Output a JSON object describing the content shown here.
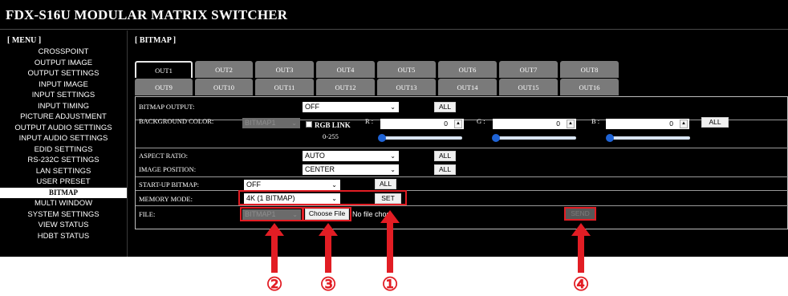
{
  "app": {
    "title": "FDX-S16U MODULAR MATRIX SWITCHER"
  },
  "menu": {
    "header": "[ MENU ]",
    "items": [
      {
        "label": "CROSSPOINT"
      },
      {
        "label": "OUTPUT IMAGE"
      },
      {
        "label": "OUTPUT SETTINGS"
      },
      {
        "label": "INPUT IMAGE"
      },
      {
        "label": "INPUT SETTINGS"
      },
      {
        "label": "INPUT TIMING"
      },
      {
        "label": "PICTURE ADJUSTMENT"
      },
      {
        "label": "OUTPUT AUDIO SETTINGS"
      },
      {
        "label": "INPUT AUDIO SETTINGS"
      },
      {
        "label": "EDID SETTINGS"
      },
      {
        "label": "RS-232C SETTINGS"
      },
      {
        "label": "LAN SETTINGS"
      },
      {
        "label": "USER PRESET"
      },
      {
        "label": "BITMAP",
        "active": true
      },
      {
        "label": "MULTI WINDOW"
      },
      {
        "label": "SYSTEM SETTINGS"
      },
      {
        "label": "VIEW STATUS"
      },
      {
        "label": "HDBT STATUS"
      }
    ]
  },
  "section": {
    "title": "[ BITMAP ]"
  },
  "tabs": {
    "active": "OUT1",
    "row1": [
      "OUT1",
      "OUT2",
      "OUT3",
      "OUT4",
      "OUT5",
      "OUT6",
      "OUT7",
      "OUT8"
    ],
    "row2": [
      "OUT9",
      "OUT10",
      "OUT11",
      "OUT12",
      "OUT13",
      "OUT14",
      "OUT15",
      "OUT16"
    ]
  },
  "bitmap_output": {
    "label": "BITMAP OUTPUT:",
    "value": "OFF",
    "all": "ALL"
  },
  "background_color": {
    "label": "BACKGROUND COLOR:",
    "bitmap_value": "BITMAP1",
    "rgb_link": "RGB LINK",
    "range": "0-255",
    "r_label": "R :",
    "r_value": "0",
    "g_label": "G :",
    "g_value": "0",
    "b_label": "B :",
    "b_value": "0",
    "all": "ALL",
    "slider_fraction": {
      "r": 0,
      "g": 0,
      "b": 0
    }
  },
  "aspect_ratio": {
    "label": "ASPECT RATIO:",
    "value": "AUTO",
    "all": "ALL"
  },
  "image_position": {
    "label": "IMAGE POSITION:",
    "value": "CENTER",
    "all": "ALL"
  },
  "startup_bitmap": {
    "label": "START-UP BITMAP:",
    "value": "OFF",
    "all": "ALL"
  },
  "memory_mode": {
    "label": "MEMORY MODE:",
    "value": "4K (1 BITMAP)",
    "set": "SET"
  },
  "file": {
    "label": "FILE:",
    "bitmap_value": "BITMAP1",
    "choose_file": "Choose File",
    "no_file": "No file chosen",
    "send": "SEND"
  },
  "callouts": {
    "c1": "①",
    "c2": "②",
    "c3": "③",
    "c4": "④"
  },
  "colors": {
    "highlight": "#e21d24",
    "slider_thumb": "#1e63d6",
    "tab_bg": "#7a7a7a"
  }
}
